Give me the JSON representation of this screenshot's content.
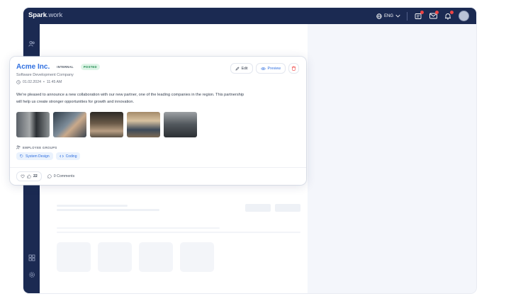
{
  "app": {
    "brand_bold": "Spark",
    "brand_light": ".work"
  },
  "topbar": {
    "language": "ENG",
    "notifications": {
      "tasks_dot": true,
      "mail_dot": true,
      "bell_dot": true
    }
  },
  "post": {
    "company": "Acme Inc.",
    "badges": {
      "internal": "INTERNAL",
      "status": "POSTED"
    },
    "subtitle": "Software Development Company",
    "date": "01.02.2024",
    "separator": "•",
    "time": "11:45 AM",
    "actions": {
      "edit": "Edit",
      "preview": "Preview"
    },
    "message": "We're pleased to announce a new collaboration with our new partner, one of the leading companies in the region. This partnership will help us create stronger opportunities for growth and innovation.",
    "groups_label": "EMPLOYEE GROUPS",
    "tags": [
      "System Design",
      "Coding"
    ],
    "reactions": {
      "likes": "22"
    },
    "comments": "0 Comments"
  },
  "colors": {
    "accent": "#2f6fe0",
    "navy": "#1b2a52",
    "posted": "#1d8a4e",
    "danger": "#ef4444"
  },
  "icons": [
    "globe-icon",
    "chevron-down-icon",
    "tasks-icon",
    "mail-icon",
    "bell-icon",
    "clock-icon",
    "pencil-icon",
    "eye-icon",
    "trash-icon",
    "users-icon",
    "tag-icon",
    "code-icon",
    "heart-icon",
    "thumbs-up-icon",
    "comment-icon"
  ]
}
